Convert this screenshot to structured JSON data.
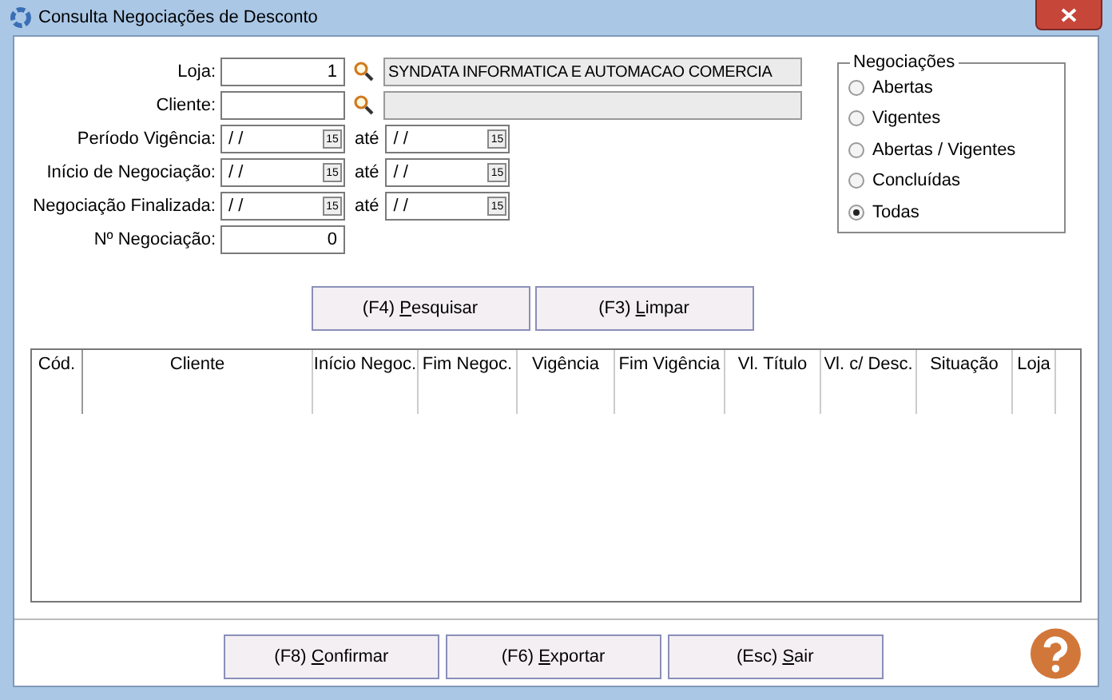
{
  "window": {
    "title": "Consulta Negociações de Desconto"
  },
  "form": {
    "rows": [
      {
        "kind": "lookup",
        "label": "Loja:",
        "value": "1",
        "description": "SYNDATA INFORMATICA E AUTOMACAO COMERCIA"
      },
      {
        "kind": "lookup",
        "label": "Cliente:"
      },
      {
        "kind": "daterange",
        "label": "Período Vigência:",
        "from": "/ /",
        "calendar_from": "15",
        "sep": "até",
        "to": "/ /",
        "calendar_to": "15"
      },
      {
        "kind": "daterange",
        "label": "Início de Negociação:",
        "from": "/ /",
        "calendar_from": "15",
        "sep": "até",
        "to": "/ /",
        "calendar_to": "15"
      },
      {
        "kind": "daterange",
        "label": "Negociação Finalizada:",
        "from": "/ /",
        "calendar_from": "15",
        "sep": "até",
        "to": "/ /",
        "calendar_to": "15"
      },
      {
        "kind": "number",
        "label": "Nº Negociação:",
        "value": "0"
      }
    ]
  },
  "negociacoes": {
    "title": "Negociações",
    "options": [
      {
        "label": "Abertas",
        "selected": false
      },
      {
        "label": "Vigentes",
        "selected": false
      },
      {
        "label": "Abertas / Vigentes",
        "selected": false
      },
      {
        "label": "Concluídas",
        "selected": false
      },
      {
        "label": "Todas",
        "selected": true
      }
    ]
  },
  "search_buttons": [
    {
      "prefix": "(F4) ",
      "key": "P",
      "rest": "esquisar"
    },
    {
      "prefix": "(F3) ",
      "key": "L",
      "rest": "impar"
    }
  ],
  "table": {
    "columns": [
      "Cód.",
      "Cliente",
      "Início Negoc.",
      "Fim Negoc.",
      "Vigência",
      "Fim Vigência",
      "Vl. Título",
      "Vl. c/ Desc.",
      "Situação",
      "Loja"
    ]
  },
  "bottom_buttons": [
    {
      "prefix": "(F8) ",
      "key": "C",
      "rest": "onfirmar"
    },
    {
      "prefix": "(F6) ",
      "key": "E",
      "rest": "xportar"
    },
    {
      "prefix": "(Esc) ",
      "key": "S",
      "rest": "air"
    }
  ]
}
